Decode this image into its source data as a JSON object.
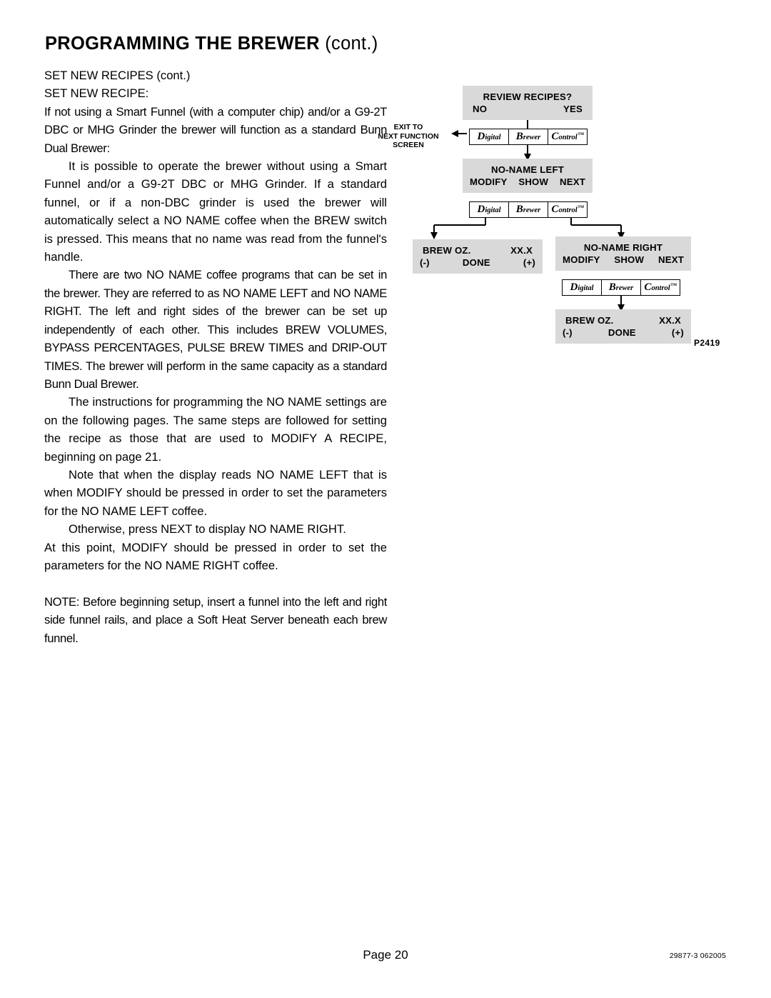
{
  "header": {
    "title_main": "PROGRAMMING THE BREWER",
    "title_cont": " (cont.)"
  },
  "body": {
    "subhead1": "SET NEW RECIPES (cont.)",
    "subhead2": "SET NEW RECIPE:",
    "para1": "If not using a Smart Funnel (with a computer chip) and/or a G9-2T DBC or MHG Grinder the brewer will function as a standard Bunn Dual Brewer:",
    "para2": "It is possible to operate the brewer without using a Smart Funnel and/or a G9-2T DBC or MHG Grinder. If a standard funnel, or if a non-DBC grinder is used the brewer will automatically select a NO NAME coffee when the BREW switch is pressed. This means that no name was read from the funnel's handle.",
    "para3": "There are two NO NAME coffee programs that can be set in the brewer. They are referred to as NO NAME LEFT and NO NAME RIGHT. The left and right sides of the brewer can be set up independently of each other. This includes BREW VOLUMES, BYPASS PERCENTAGES, PULSE BREW TIMES and DRIP-OUT TIMES. The brewer will perform in the same capacity as a standard Bunn Dual Brewer.",
    "para4": "The instructions for programming the NO NAME settings are on the following pages. The same steps are followed for setting the recipe as those that are used to MODIFY A RECIPE, beginning on page 21.",
    "para5": "Note that when the display reads NO NAME LEFT that is when MODIFY should be pressed in order to set the parameters for the NO NAME LEFT coffee.",
    "para6": "Otherwise, press NEXT to display NO NAME RIGHT.",
    "para7": "At this point, MODIFY should be pressed in order to set the parameters for the NO NAME RIGHT coffee.",
    "note": "NOTE: Before beginning setup, insert a funnel into the left and right side funnel rails, and place a Soft Heat Server beneath each brew funnel."
  },
  "diagram": {
    "screen1": {
      "line1": "REVIEW RECIPES?",
      "left": "NO",
      "right": "YES"
    },
    "exit_label": "EXIT TO\nNEXT FUNCTION\nSCREEN",
    "panel": {
      "cell1_cap": "D",
      "cell1_rest": "igital",
      "cell2_cap": "B",
      "cell2_rest": "rewer",
      "cell3_cap": "C",
      "cell3_rest": "ontrol",
      "cell3_tm": "TM"
    },
    "screen2": {
      "line1": "NO-NAME LEFT",
      "left": "MODIFY",
      "mid": "SHOW",
      "right": "NEXT"
    },
    "screen3": {
      "line1_left": "BREW OZ.",
      "line1_right": "XX.X",
      "left": "(-)",
      "mid": "DONE",
      "right": "(+)"
    },
    "screen4": {
      "line1": "NO-NAME RIGHT",
      "left": "MODIFY",
      "mid": "SHOW",
      "right": "NEXT"
    },
    "screen5": {
      "line1_left": "BREW OZ.",
      "line1_right": "XX.X",
      "left": "(-)",
      "mid": "DONE",
      "right": "(+)"
    },
    "code": "P2419"
  },
  "footer": {
    "page": "Page 20",
    "doc_code": "29877-3 062005"
  }
}
